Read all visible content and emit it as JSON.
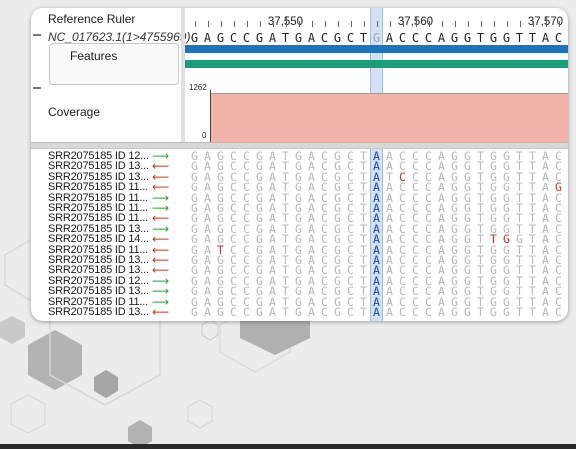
{
  "header": {
    "reference_ruler_label": "Reference Ruler",
    "reference_id": "NC_017623.1(1>4755969)",
    "features_label": "Features",
    "coverage_label": "Coverage"
  },
  "ruler": {
    "ticks": [
      {
        "label": "37,550",
        "base_index": 7
      },
      {
        "label": "37,560",
        "base_index": 17
      },
      {
        "label": "37,570",
        "base_index": 27
      }
    ]
  },
  "reference_sequence": "GAGCCGATGACGCTGACCCAGGTGGTTAC",
  "highlight_base_index": 14,
  "features": {
    "track1_color": "#1f73b7",
    "track2_color": "#1b9c78"
  },
  "coverage": {
    "max_label": "1262",
    "min_label": "0",
    "fill_color": "#f2b3a8"
  },
  "reads": [
    {
      "name": "SRR2075185 ID 12...",
      "strand": "forward",
      "seq": "GAGCCGATGACGCTAACCCAGGTGGTTAC",
      "mismatches": []
    },
    {
      "name": "SRR2075185 ID 13...",
      "strand": "reverse",
      "seq": "GAGCCGATGACGCTAACCCAGGTGGTTAC",
      "mismatches": []
    },
    {
      "name": "SRR2075185 ID 13...",
      "strand": "reverse",
      "seq": "GAGCCGATGACGCTATCCCAGGTGGTTAC",
      "mismatches": [
        16
      ]
    },
    {
      "name": "SRR2075185 ID 11...",
      "strand": "reverse",
      "seq": "GAGCCGATGACGCTAACCCAGGTGGTTAG",
      "mismatches": [
        28
      ]
    },
    {
      "name": "SRR2075185 ID 11...",
      "strand": "forward",
      "seq": "GAGCCGATGACGCTAACCCAGGTGGTTAC",
      "mismatches": []
    },
    {
      "name": "SRR2075185 ID 11...",
      "strand": "forward",
      "seq": "GAGCCGATGACGCTAACCCAGGTGGTTAC",
      "mismatches": []
    },
    {
      "name": "SRR2075185 ID 11...",
      "strand": "reverse",
      "seq": "GAGCCGATGACGCTAACCCAGGTGGTTAC",
      "mismatches": []
    },
    {
      "name": "SRR2075185 ID 13...",
      "strand": "forward",
      "seq": "GAGCCGATGACGCTAACCCAGGTGGTTAC",
      "mismatches": []
    },
    {
      "name": "SRR2075185 ID 14...",
      "strand": "reverse",
      "seq": "GAGCCGATGACGCTAACCCAGGTTGGTAC",
      "mismatches": [
        23,
        24
      ]
    },
    {
      "name": "SRR2075185 ID 11...",
      "strand": "reverse",
      "seq": "GATCCGATGACGCTAACCCAGGTGGTTAC",
      "mismatches": [
        2
      ]
    },
    {
      "name": "SRR2075185 ID 13...",
      "strand": "reverse",
      "seq": "GAGCCGATGACGCTAACCCAGGTGGTTAC",
      "mismatches": []
    },
    {
      "name": "SRR2075185 ID 13...",
      "strand": "reverse",
      "seq": "GAGCCGATGACGCTAACCCAGGTGGTTAC",
      "mismatches": []
    },
    {
      "name": "SRR2075185 ID 12...",
      "strand": "forward",
      "seq": "GAGCCGATGACGCTAACCCAGGTGGTTAC",
      "mismatches": []
    },
    {
      "name": "SRR2075185 ID 13...",
      "strand": "forward",
      "seq": "GAGCCGATGACGCTAACCCAGGTGGTTAC",
      "mismatches": []
    },
    {
      "name": "SRR2075185 ID 11...",
      "strand": "forward",
      "seq": "GAGCCGATGACGCTAACCCAGGTGGTTAC",
      "mismatches": []
    },
    {
      "name": "SRR2075185 ID 13...",
      "strand": "reverse",
      "seq": "GAGCCGATGACGCTAACCCAGGTGGTTAC",
      "mismatches": []
    }
  ]
}
